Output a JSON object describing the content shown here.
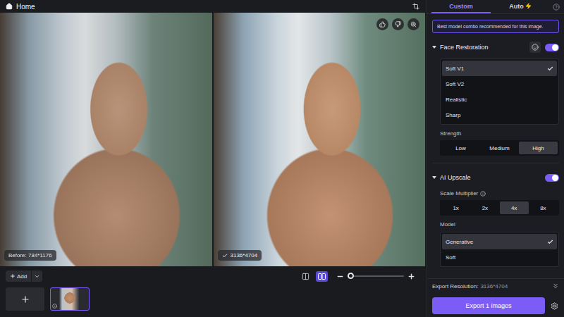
{
  "top_bar": {
    "title": "Home"
  },
  "preview": {
    "before_label": "Before: 784*1176",
    "after_label": "3136*4704"
  },
  "toolbar": {
    "add_label": "Add",
    "view_modes": [
      {
        "mode": "split",
        "selected": false
      },
      {
        "mode": "side-by-side",
        "selected": true
      }
    ],
    "zoom": {
      "level": 0.05
    }
  },
  "thumbnails": [
    {
      "selected": true
    }
  ],
  "panel": {
    "tabs": [
      {
        "label": "Custom",
        "selected": true
      },
      {
        "label": "Auto",
        "selected": false
      }
    ],
    "banner": "Best model combo recommended for this image.",
    "face_restoration": {
      "title": "Face Restoration",
      "enabled": true,
      "models": [
        {
          "label": "Soft V1",
          "selected": true
        },
        {
          "label": "Soft V2",
          "selected": false
        },
        {
          "label": "Realistic",
          "selected": false
        },
        {
          "label": "Sharp",
          "selected": false
        }
      ],
      "strength_label": "Strength",
      "strengths": [
        {
          "label": "Low",
          "selected": false
        },
        {
          "label": "Medium",
          "selected": false
        },
        {
          "label": "High",
          "selected": true
        }
      ]
    },
    "ai_upscale": {
      "title": "AI Upscale",
      "enabled": true,
      "scale_label": "Scale Multiplier",
      "scales": [
        {
          "label": "1x",
          "selected": false
        },
        {
          "label": "2x",
          "selected": false
        },
        {
          "label": "4x",
          "selected": true
        },
        {
          "label": "8x",
          "selected": false
        }
      ],
      "model_label": "Model",
      "models": [
        {
          "label": "Generative",
          "selected": true
        },
        {
          "label": "Soft",
          "selected": false
        }
      ]
    },
    "export": {
      "resolution_label": "Export Resolution:",
      "resolution_value": "3136*4704",
      "button": "Export 1 images"
    }
  }
}
